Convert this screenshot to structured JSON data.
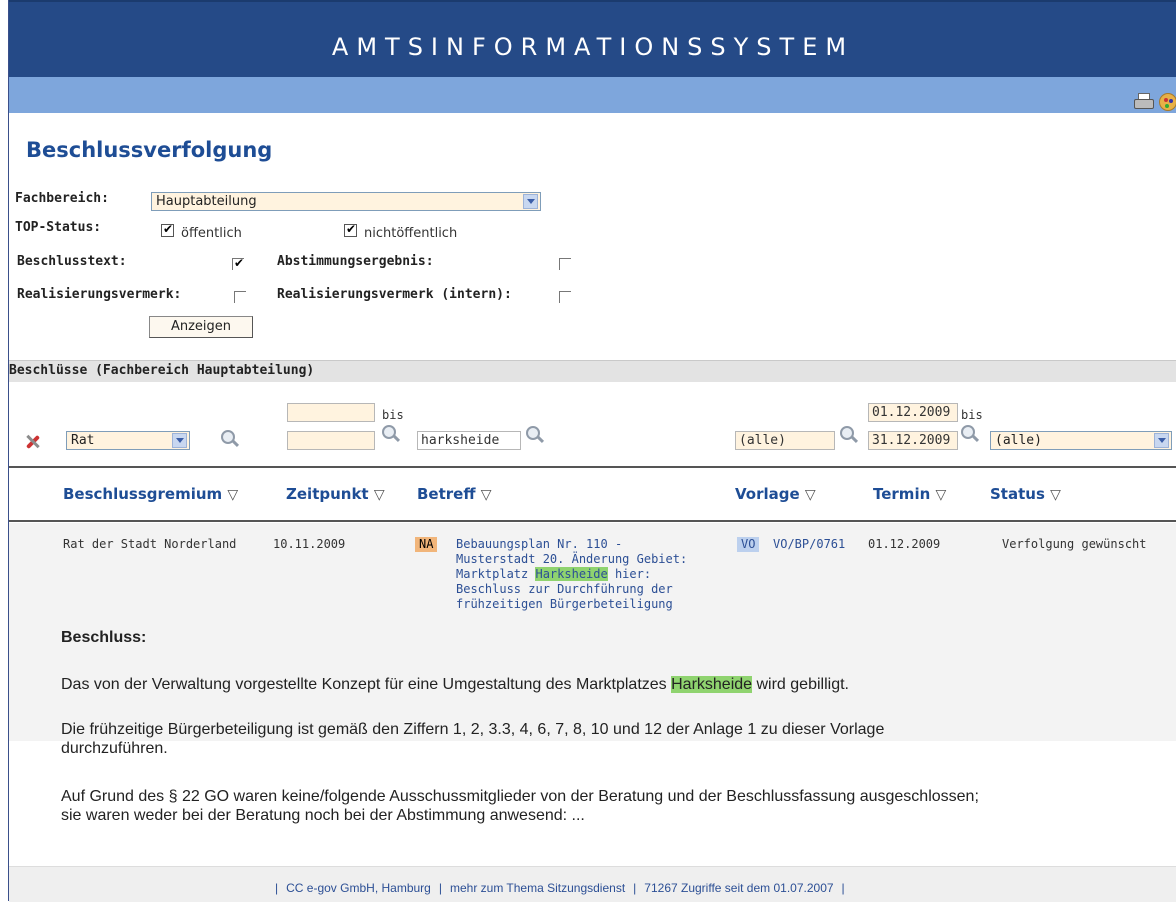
{
  "banner": {
    "title": "AMTSINFORMATIONSSYSTEM"
  },
  "toolbar": {
    "icons": [
      "printer-icon",
      "palette-icon"
    ]
  },
  "page_title": "Beschlussverfolgung",
  "form": {
    "fachbereich_label": "Fachbereich:",
    "fachbereich_value": "Hauptabteilung",
    "top_status_label": "TOP-Status:",
    "oeffentlich_label": "öffentlich",
    "oeffentlich_checked": true,
    "nichtoeffentlich_label": "nichtöffentlich",
    "nichtoeffentlich_checked": true,
    "beschlusstext_label": "Beschlusstext:",
    "beschlusstext_checked": true,
    "abstimmung_label": "Abstimmungsergebnis:",
    "abstimmung_checked": false,
    "realisierung_label": "Realisierungsvermerk:",
    "realisierung_checked": false,
    "realisierung_intern_label": "Realisierungsvermerk (intern):",
    "realisierung_intern_checked": false,
    "submit_label": "Anzeigen"
  },
  "section_title": "Beschlüsse (Fachbereich Hauptabteilung)",
  "filters": {
    "gremium_value": "Rat",
    "zeit_from": "",
    "zeit_bis": "bis",
    "zeit_to": "",
    "betreff_value": "harksheide",
    "vorlage_value": "(alle)",
    "termin_from": "01.12.2009",
    "termin_bis": "bis",
    "termin_to": "31.12.2009",
    "status_value": "(alle)"
  },
  "columns": [
    {
      "label": "Beschlussgremium"
    },
    {
      "label": "Zeitpunkt"
    },
    {
      "label": "Betreff"
    },
    {
      "label": "Vorlage"
    },
    {
      "label": "Termin"
    },
    {
      "label": "Status"
    }
  ],
  "sort_glyph": "▽",
  "row": {
    "gremium": "Rat der Stadt Norderland",
    "zeitpunkt": "10.11.2009",
    "top_tag": "NA",
    "betreff_line1": "Bebauungsplan Nr. 110 -",
    "betreff_line2": "Musterstadt 20. Änderung Gebiet:",
    "betreff_line3_pre": "Marktplatz ",
    "betreff_line3_hl": "Harksheide",
    "betreff_line3_post": " hier:",
    "betreff_line4": "Beschluss zur Durchführung der",
    "betreff_line5": "frühzeitigen Bürgerbeteiligung",
    "vorlage_tag": "VO",
    "vorlage": "VO/BP/0761",
    "termin": "01.12.2009",
    "status": "Verfolgung gewünscht"
  },
  "beschluss": {
    "heading": "Beschluss:",
    "p1_pre": "Das von der Verwaltung vorgestellte Konzept für eine Umgestaltung des Marktplatzes ",
    "p1_hl": "Harksheide",
    "p1_post": " wird gebilligt.",
    "p2_line1": "Die frühzeitige Bürgerbeteiligung ist gemäß den Ziffern 1, 2, 3.3, 4, 6, 7, 8, 10 und 12 der Anlage 1 zu dieser Vorlage",
    "p2_line2": "durchzuführen.",
    "p3_line1": "Auf Grund des § 22 GO waren keine/folgende Ausschussmitglieder von der Beratung und der Beschlussfassung ausgeschlossen;",
    "p3_line2": "sie waren weder bei der Beratung noch bei der Abstimmung anwesend: ..."
  },
  "footer": {
    "link1": "CC e-gov GmbH, Hamburg",
    "link2": "mehr zum Thema Sitzungsdienst",
    "counter": "71267 Zugriffe seit dem 01.07.2007",
    "separator": "|"
  },
  "colors": {
    "banner": "#254a87",
    "toolbar": "#7ea6dc",
    "heading": "#1e4d95",
    "highlight": "#8fd36f",
    "na_tag": "#f1b57a",
    "vo_tag": "#bcd0ee"
  }
}
